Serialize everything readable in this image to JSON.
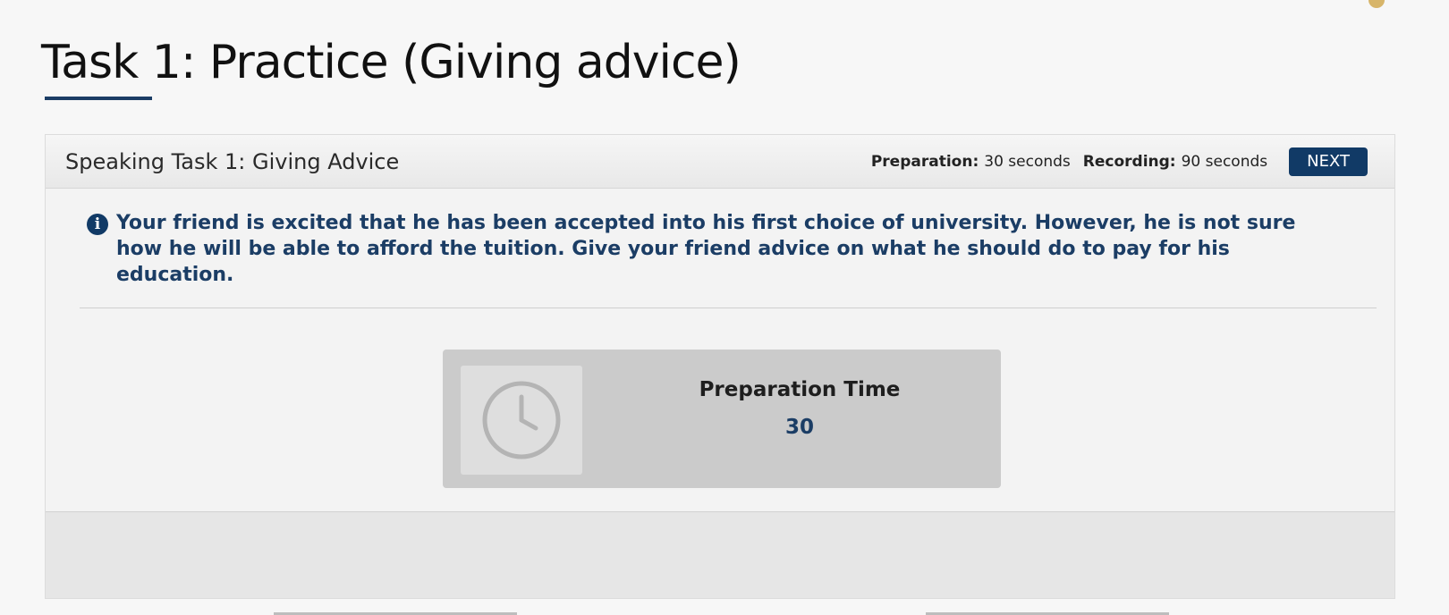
{
  "slide": {
    "title": "Task 1: Practice (Giving advice)"
  },
  "task": {
    "header_title": "Speaking Task 1: Giving Advice",
    "preparation_label": "Preparation:",
    "preparation_value": "30 seconds",
    "recording_label": "Recording:",
    "recording_value": "90 seconds",
    "next_label": "NEXT",
    "prompt": "Your friend is excited that he has been accepted into his first choice of university. However, he is not sure how he will be able to afford the tuition. Give your friend advice on what he should do to pay for his education.",
    "info_icon_glyph": "i",
    "prep_time_label": "Preparation Time",
    "prep_time_value": "30"
  },
  "colors": {
    "accent": "#113a66",
    "prompt_text": "#1b3d65",
    "timer_panel": "#cbcbcb",
    "page_background": "#f7f7f7"
  },
  "icons": {
    "info": "info-icon",
    "clock": "clock-icon"
  }
}
